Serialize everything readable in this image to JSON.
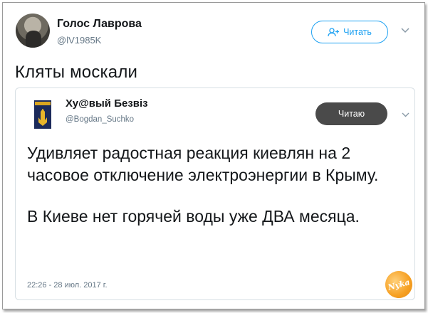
{
  "tweet": {
    "author_name": "Голос Лаврова",
    "author_handle": "@lV1985K",
    "follow_label": "Читать",
    "text": "Кляты москали"
  },
  "quoted_tweet": {
    "author_name": "Ху@вый Безвіз",
    "author_handle": "@Bogdan_Suchko",
    "follow_label": "Читаю",
    "paragraph_1": "Удивляет радостная реакция киевлян  на 2 часовое отключение электроэнергии в Крыму.",
    "paragraph_2": "В Киеве нет горячей воды  уже ДВА месяца.",
    "timestamp": "22:26 - 28 июл. 2017 г."
  },
  "watermark": {
    "text": "Nyka"
  },
  "colors": {
    "accent": "#1da1f2",
    "following_button": "#4a4a4a",
    "secondary_text": "#657786",
    "quote_border": "#d7dfe4"
  }
}
